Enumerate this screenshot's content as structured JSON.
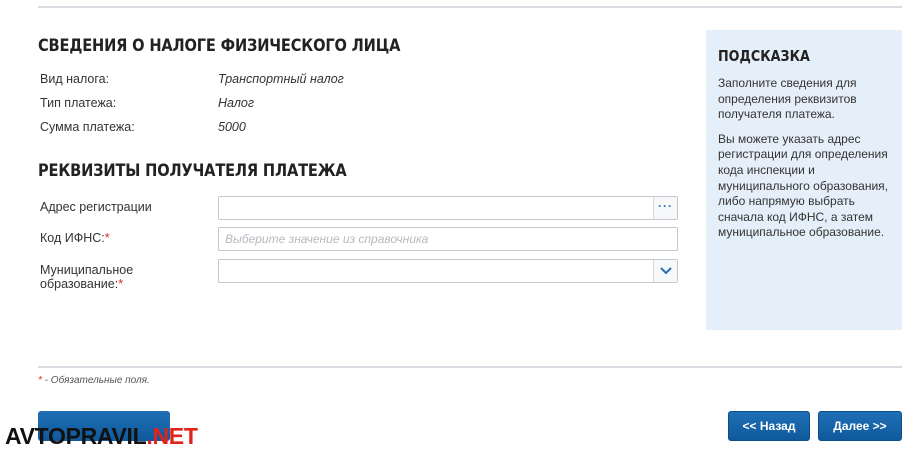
{
  "tax_info": {
    "title": "СВЕДЕНИЯ О НАЛОГЕ ФИЗИЧЕСКОГО ЛИЦА",
    "rows": [
      {
        "label": "Вид налога:",
        "value": "Транспортный налог"
      },
      {
        "label": "Тип платежа:",
        "value": "Налог"
      },
      {
        "label": "Сумма платежа:",
        "value": "5000"
      }
    ]
  },
  "recipient": {
    "title": "РЕКВИЗИТЫ ПОЛУЧАТЕЛЯ ПЛАТЕЖА",
    "address": {
      "label": "Адрес регистрации",
      "value": "",
      "button_glyph": "···"
    },
    "ifns": {
      "label": "Код ИФНС:",
      "required_mark": "*",
      "placeholder": "Выберите значение из справочника",
      "value": ""
    },
    "municipality": {
      "label_line1": "Муниципальное",
      "label_line2": "образование:",
      "required_mark": "*",
      "value": ""
    }
  },
  "hint": {
    "title": "ПОДСКАЗКА",
    "paragraph1": "Заполните сведения для определения реквизитов получателя платежа.",
    "paragraph2": "Вы можете указать адрес регистрации для определения кода инспекции и муниципального образования, либо напрямую выбрать сначала код ИФНС, а затем муниципальное образование."
  },
  "footer": {
    "required_mark": "*",
    "required_note": " - Обязательные поля.",
    "back_label": "<< Назад",
    "next_label": "Далее >>"
  },
  "watermark": {
    "part1": "AVTOPRAVIL",
    "part2": ".NET"
  },
  "colors": {
    "accent": "#1565ad",
    "hint_bg": "#e5eff9",
    "required": "#e02020",
    "watermark_red": "#e3231b"
  }
}
